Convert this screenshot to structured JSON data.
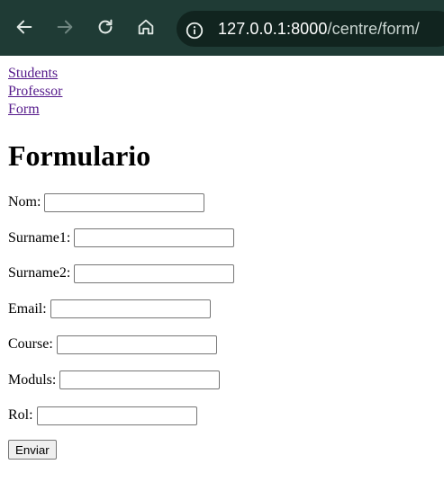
{
  "browser": {
    "url_host": "127.0.0.1:8000",
    "url_path": "/centre/form/",
    "icons": [
      "back-icon",
      "forward-icon",
      "reload-icon",
      "home-icon",
      "site-info-icon"
    ]
  },
  "nav_links": [
    "Students",
    "Professor",
    "Form"
  ],
  "page_title": "Formulario",
  "form": {
    "fields": [
      {
        "label": "Nom:",
        "value": ""
      },
      {
        "label": "Surname1:",
        "value": ""
      },
      {
        "label": "Surname2:",
        "value": ""
      },
      {
        "label": "Email:",
        "value": ""
      },
      {
        "label": "Course:",
        "value": ""
      },
      {
        "label": "Moduls:",
        "value": ""
      },
      {
        "label": "Rol:",
        "value": ""
      }
    ],
    "submit_label": "Enviar"
  }
}
